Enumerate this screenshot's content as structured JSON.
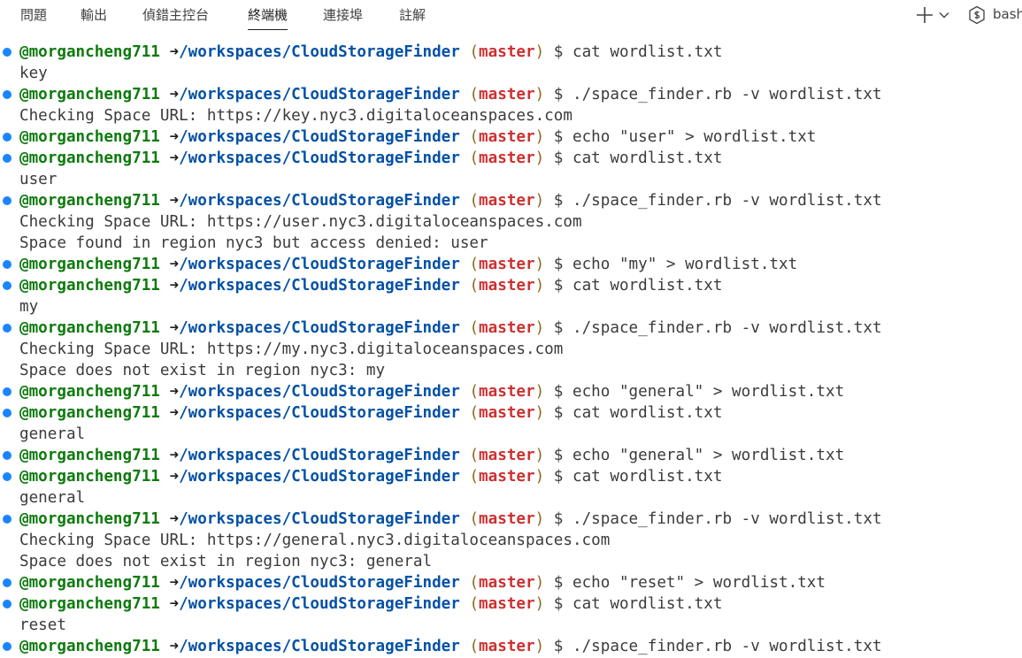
{
  "panel": {
    "tabs": [
      {
        "label": "問題"
      },
      {
        "label": "輸出"
      },
      {
        "label": "偵錯主控台"
      },
      {
        "label": "終端機"
      },
      {
        "label": "連接埠"
      },
      {
        "label": "註解"
      }
    ],
    "active_tab": "終端機",
    "profile_label": "bash",
    "icons": {
      "new_terminal": "plus-icon",
      "profile_menu": "chevron-down-icon",
      "profile": "terminal-icon"
    }
  },
  "prompt": {
    "user": "@morgancheng711",
    "arrow": "➜",
    "path": "/workspaces/CloudStorageFinder",
    "open_paren": "(",
    "branch": "master",
    "close_paren": ")",
    "dollar": "$"
  },
  "terminal_lines": [
    {
      "type": "prompt",
      "command": "cat wordlist.txt"
    },
    {
      "type": "output",
      "text": "key"
    },
    {
      "type": "prompt",
      "command": "./space_finder.rb -v wordlist.txt"
    },
    {
      "type": "output",
      "text": "Checking Space URL: https://key.nyc3.digitaloceanspaces.com"
    },
    {
      "type": "prompt",
      "command": "echo \"user\" > wordlist.txt"
    },
    {
      "type": "prompt",
      "command": "cat wordlist.txt"
    },
    {
      "type": "output",
      "text": "user"
    },
    {
      "type": "prompt",
      "command": "./space_finder.rb -v wordlist.txt"
    },
    {
      "type": "output",
      "text": "Checking Space URL: https://user.nyc3.digitaloceanspaces.com"
    },
    {
      "type": "output",
      "text": "Space found in region nyc3 but access denied: user"
    },
    {
      "type": "prompt",
      "command": "echo \"my\" > wordlist.txt"
    },
    {
      "type": "prompt",
      "command": "cat wordlist.txt"
    },
    {
      "type": "output",
      "text": "my"
    },
    {
      "type": "prompt",
      "command": "./space_finder.rb -v wordlist.txt"
    },
    {
      "type": "output",
      "text": "Checking Space URL: https://my.nyc3.digitaloceanspaces.com"
    },
    {
      "type": "output",
      "text": "Space does not exist in region nyc3: my"
    },
    {
      "type": "prompt",
      "command": "echo \"general\" > wordlist.txt"
    },
    {
      "type": "prompt",
      "command": "cat wordlist.txt"
    },
    {
      "type": "output",
      "text": "general"
    },
    {
      "type": "prompt",
      "command": "echo \"general\" > wordlist.txt"
    },
    {
      "type": "prompt",
      "command": "cat wordlist.txt"
    },
    {
      "type": "output",
      "text": "general"
    },
    {
      "type": "prompt",
      "command": "./space_finder.rb -v wordlist.txt"
    },
    {
      "type": "output",
      "text": "Checking Space URL: https://general.nyc3.digitaloceanspaces.com"
    },
    {
      "type": "output",
      "text": "Space does not exist in region nyc3: general"
    },
    {
      "type": "prompt",
      "command": "echo \"reset\" > wordlist.txt"
    },
    {
      "type": "prompt",
      "command": "cat wordlist.txt"
    },
    {
      "type": "output",
      "text": "reset"
    },
    {
      "type": "prompt",
      "command": "./space_finder.rb -v wordlist.txt"
    }
  ],
  "colors": {
    "user": "#0e7a0e",
    "path": "#0451a5",
    "branch": "#cd3131",
    "decoration": "#1a85ff",
    "text": "#3b3b3b"
  }
}
